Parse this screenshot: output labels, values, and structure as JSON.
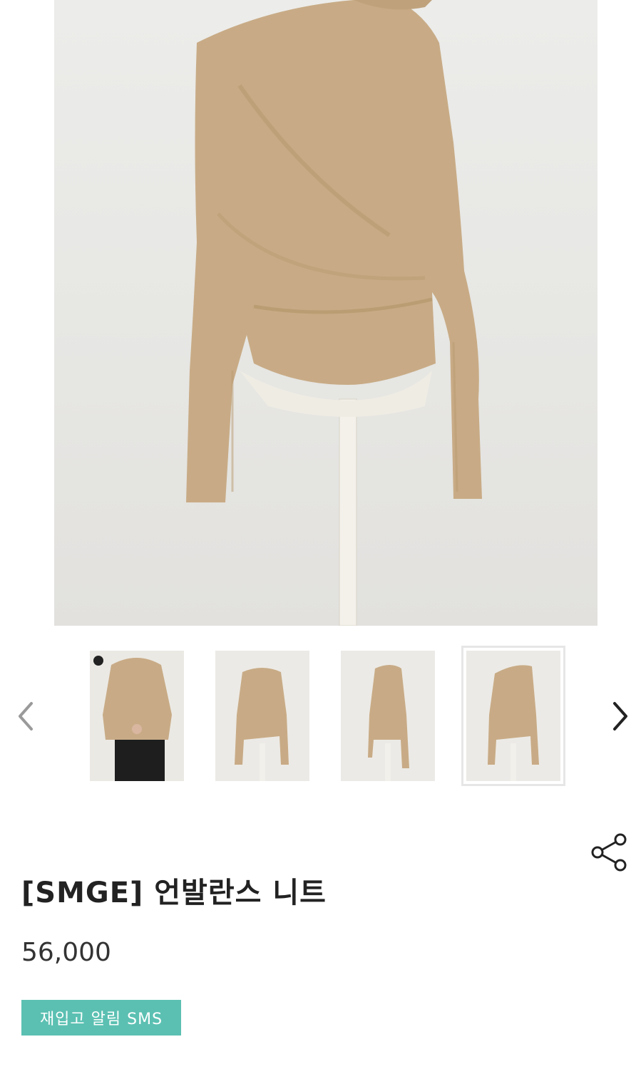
{
  "product": {
    "title": "[SMGE] 언발란스 니트",
    "price": "56,000",
    "restock_button": "재입고 알림 SMS"
  },
  "gallery": {
    "thumbnail_count": 4,
    "selected_index": 3
  },
  "icons": {
    "prev": "chevron-left-icon",
    "next": "chevron-right-icon",
    "share": "share-icon"
  },
  "colors": {
    "knit": "#c8ab86",
    "button": "#5bc0b2",
    "background": "#e8e7e4"
  }
}
